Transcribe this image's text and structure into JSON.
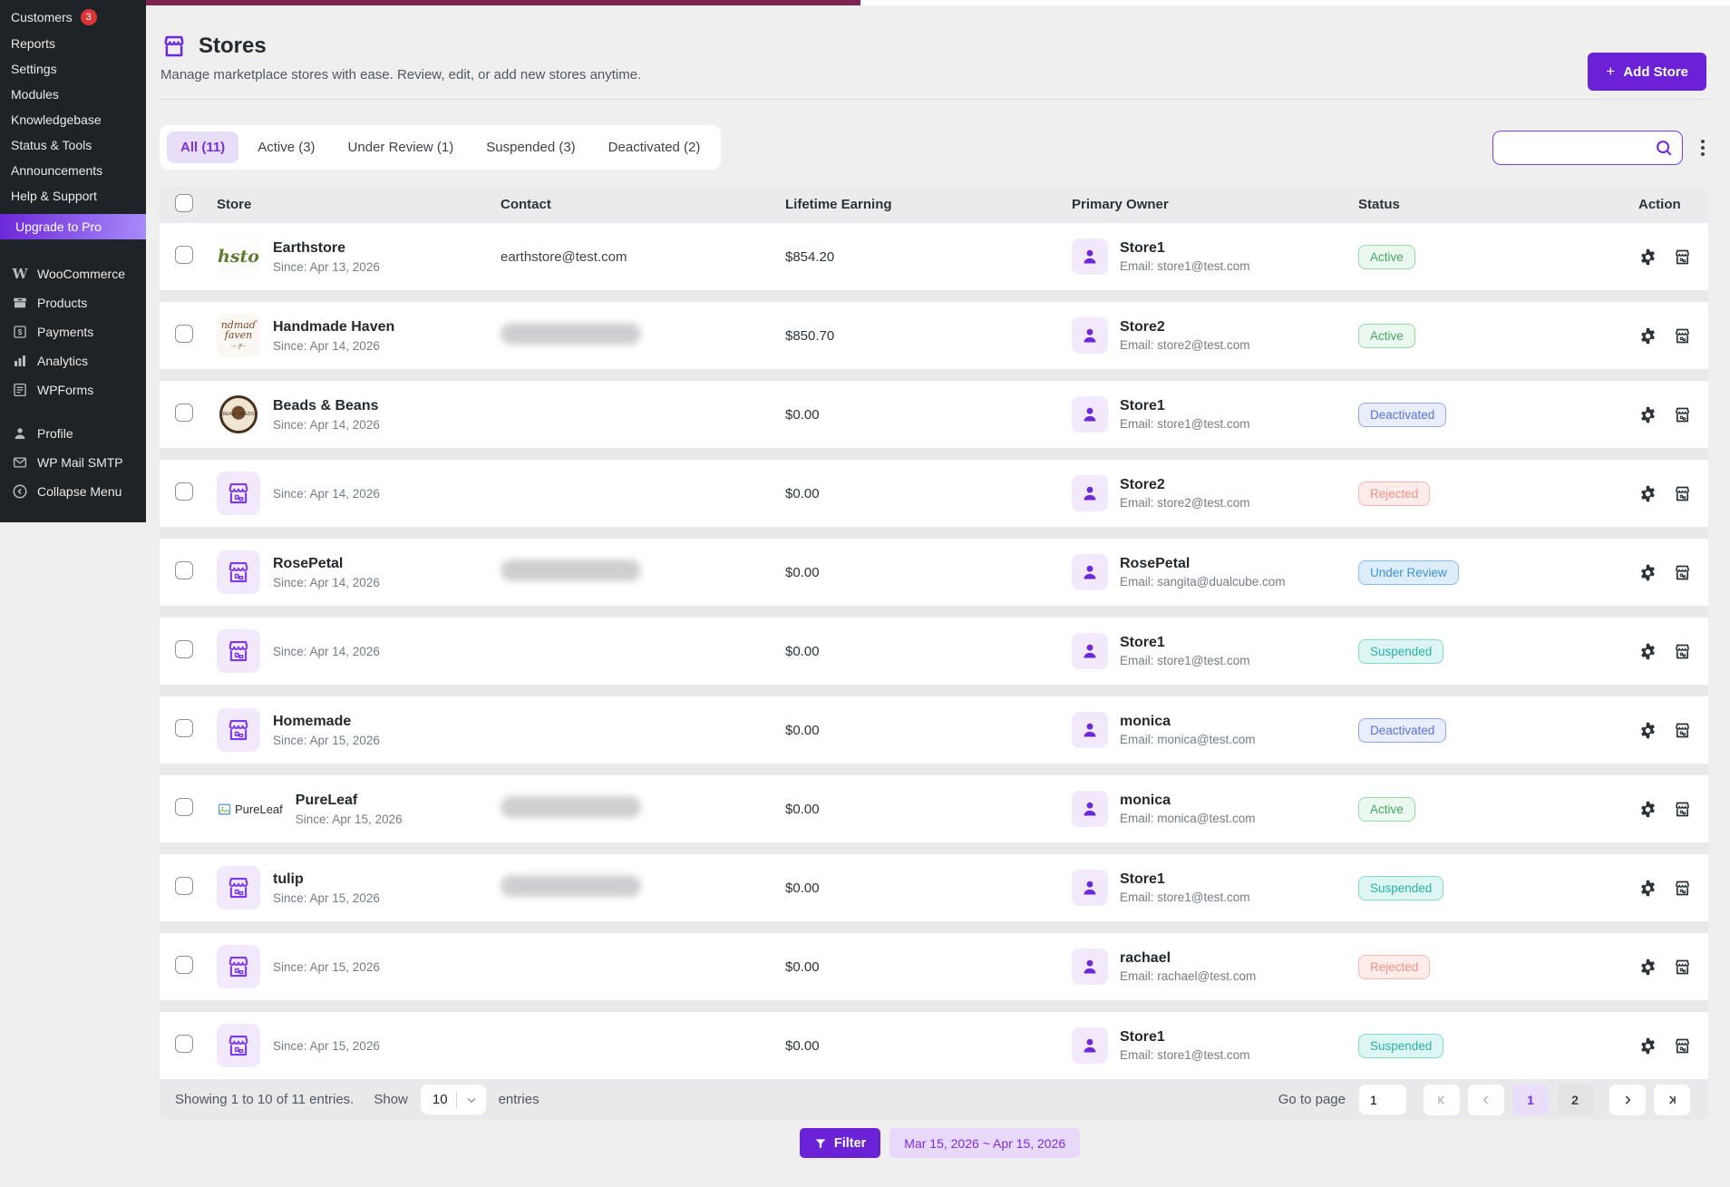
{
  "sidebar": {
    "top_items": [
      {
        "label": "Customers",
        "badge": "3"
      },
      {
        "label": "Reports"
      },
      {
        "label": "Settings"
      },
      {
        "label": "Modules"
      },
      {
        "label": "Knowledgebase"
      },
      {
        "label": "Status & Tools"
      },
      {
        "label": "Announcements"
      },
      {
        "label": "Help & Support"
      }
    ],
    "upgrade_label": "Upgrade to Pro",
    "plugin_items": [
      {
        "label": "WooCommerce",
        "icon": "woocommerce-icon"
      },
      {
        "label": "Products",
        "icon": "products-icon"
      },
      {
        "label": "Payments",
        "icon": "payments-icon"
      },
      {
        "label": "Analytics",
        "icon": "analytics-icon"
      },
      {
        "label": "WPForms",
        "icon": "wpforms-icon"
      }
    ],
    "user_items": [
      {
        "label": "Profile",
        "icon": "profile-icon"
      },
      {
        "label": "WP Mail SMTP",
        "icon": "mail-icon"
      }
    ],
    "collapse_label": "Collapse Menu"
  },
  "header": {
    "title": "Stores",
    "subtitle": "Manage marketplace stores with ease. Review, edit, or add new stores anytime.",
    "add_store_label": "Add Store"
  },
  "tabs": [
    {
      "label": "All (11)",
      "active": true
    },
    {
      "label": "Active (3)",
      "active": false
    },
    {
      "label": "Under Review (1)",
      "active": false
    },
    {
      "label": "Suspended (3)",
      "active": false
    },
    {
      "label": "Deactivated (2)",
      "active": false
    }
  ],
  "search": {
    "placeholder": ""
  },
  "table": {
    "columns": [
      "Store",
      "Contact",
      "Lifetime Earning",
      "Primary Owner",
      "Status",
      "Action"
    ],
    "rows": [
      {
        "name": "Earthstore",
        "since": "Since: Apr 13, 2026",
        "logo": "earthstore",
        "contact": "earthstore@test.com",
        "contact_blurred": false,
        "earning": "$854.20",
        "owner": "Store1",
        "owner_email": "Email: store1@test.com",
        "status": "Active"
      },
      {
        "name": "Handmade Haven",
        "since": "Since: Apr 14, 2026",
        "logo": "handmade",
        "contact": "",
        "contact_blurred": true,
        "earning": "$850.70",
        "owner": "Store2",
        "owner_email": "Email: store2@test.com",
        "status": "Active"
      },
      {
        "name": "Beads & Beans",
        "since": "Since: Apr 14, 2026",
        "logo": "beads",
        "contact": "",
        "contact_blurred": false,
        "earning": "$0.00",
        "owner": "Store1",
        "owner_email": "Email: store1@test.com",
        "status": "Deactivated"
      },
      {
        "name": "",
        "since": "Since: Apr 14, 2026",
        "logo": "default",
        "contact": "",
        "contact_blurred": false,
        "earning": "$0.00",
        "owner": "Store2",
        "owner_email": "Email: store2@test.com",
        "status": "Rejected"
      },
      {
        "name": "RosePetal",
        "since": "Since: Apr 14, 2026",
        "logo": "default",
        "contact": "",
        "contact_blurred": true,
        "earning": "$0.00",
        "owner": "RosePetal",
        "owner_email": "Email: sangita@dualcube.com",
        "status": "Under Review"
      },
      {
        "name": "",
        "since": "Since: Apr 14, 2026",
        "logo": "default",
        "contact": "",
        "contact_blurred": false,
        "earning": "$0.00",
        "owner": "Store1",
        "owner_email": "Email: store1@test.com",
        "status": "Suspended"
      },
      {
        "name": "Homemade",
        "since": "Since: Apr 15, 2026",
        "logo": "default",
        "contact": "",
        "contact_blurred": false,
        "earning": "$0.00",
        "owner": "monica",
        "owner_email": "Email: monica@test.com",
        "status": "Deactivated"
      },
      {
        "name": "PureLeaf",
        "since": "Since: Apr 15, 2026",
        "logo": "broken",
        "broken_alt": "PureLeaf",
        "contact": "",
        "contact_blurred": true,
        "earning": "$0.00",
        "owner": "monica",
        "owner_email": "Email: monica@test.com",
        "status": "Active"
      },
      {
        "name": "tulip",
        "since": "Since: Apr 15, 2026",
        "logo": "default",
        "contact": "",
        "contact_blurred": true,
        "earning": "$0.00",
        "owner": "Store1",
        "owner_email": "Email: store1@test.com",
        "status": "Suspended"
      },
      {
        "name": "",
        "since": "Since: Apr 15, 2026",
        "logo": "default",
        "contact": "",
        "contact_blurred": false,
        "earning": "$0.00",
        "owner": "rachael",
        "owner_email": "Email: rachael@test.com",
        "status": "Rejected"
      },
      {
        "name": "",
        "since": "Since: Apr 15, 2026",
        "logo": "default",
        "contact": "",
        "contact_blurred": false,
        "earning": "$0.00",
        "owner": "Store1",
        "owner_email": "Email: store1@test.com",
        "status": "Suspended"
      }
    ]
  },
  "footer": {
    "showing_text": "Showing 1 to 10 of 11 entries.",
    "show_label": "Show",
    "page_size": "10",
    "entries_label": "entries",
    "goto_label": "Go to page",
    "goto_value": "1",
    "pages": [
      {
        "label": "1",
        "active": true
      },
      {
        "label": "2",
        "active": false
      }
    ]
  },
  "filter_bar": {
    "button_label": "Filter",
    "date_range": "Mar 15, 2026 ~ Apr 15, 2026"
  },
  "colors": {
    "accent_purple": "#6b21d6",
    "active_green": "#49a564",
    "deactivated_indigo": "#5b74d8",
    "rejected_salmon": "#ef9288",
    "under_review_blue": "#4292d6",
    "suspended_teal": "#27b2a2",
    "notification_red": "#d63638",
    "progress_maroon": "#7e2553"
  }
}
